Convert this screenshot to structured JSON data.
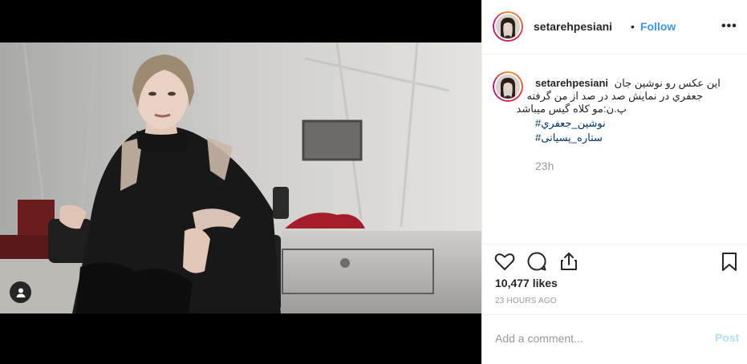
{
  "post": {
    "username": "setarehpesiani",
    "separator": "•",
    "follow_label": "Follow",
    "more_icon": "more-options-icon",
    "more_label": "•••"
  },
  "caption": {
    "username": "setarehpesiani",
    "line1": "این عکس رو نوشین جان",
    "line2": "جعفري در نمايش صد در صد از من گرفته",
    "line3": "پ.ن:مو کلاه گیس میباشد",
    "hashtag1": "#نوشين_جعفري",
    "hashtag2": "#ستاره_پسیانی",
    "time": "23h"
  },
  "actions": {
    "icons": [
      "heart-icon",
      "comment-icon",
      "share-icon",
      "bookmark-icon"
    ]
  },
  "stats": {
    "likes": "10,477 likes",
    "posted": "23 HOURS AGO"
  },
  "comment_box": {
    "placeholder": "Add a comment...",
    "post_label": "Post"
  },
  "colors": {
    "link": "#3897f0",
    "hashtag": "#003569",
    "post_disabled": "#b2dffc",
    "muted": "#999999"
  }
}
